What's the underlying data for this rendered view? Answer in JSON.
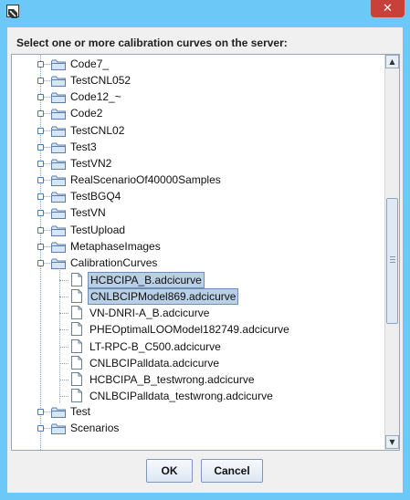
{
  "window": {
    "close_symbol": "✕"
  },
  "dialog": {
    "prompt": "Select one or more calibration curves on the server:",
    "ok_label": "OK",
    "cancel_label": "Cancel"
  },
  "tree": {
    "folders_before": [
      "Code7_",
      "TestCNL052",
      "Code12_~",
      "Code2",
      "TestCNL02",
      "Test3",
      "TestVN2",
      "RealScenarioOf40000Samples",
      "TestBGQ4",
      "TestVN",
      "TestUpload",
      "MetaphaseImages"
    ],
    "expanded_folder": "CalibrationCurves",
    "files": [
      {
        "label": "HCBCIPA_B.adcicurve",
        "selected": true
      },
      {
        "label": "CNLBCIPModel869.adcicurve",
        "selected": true
      },
      {
        "label": "VN-DNRI-A_B.adcicurve",
        "selected": false
      },
      {
        "label": "PHEOptimalLOOModel182749.adcicurve",
        "selected": false
      },
      {
        "label": "LT-RPC-B_C500.adcicurve",
        "selected": false
      },
      {
        "label": "CNLBCIPalldata.adcicurve",
        "selected": false
      },
      {
        "label": "HCBCIPA_B_testwrong.adcicurve",
        "selected": false
      },
      {
        "label": "CNLBCIPalldata_testwrong.adcicurve",
        "selected": false
      }
    ],
    "folders_after": [
      "Test",
      "Scenarios"
    ]
  },
  "colors": {
    "titlebar": "#6cc9f7",
    "close": "#c7403a",
    "selection": "#b8cfe5",
    "folder": "#d6e6f7"
  },
  "icons": {
    "folder": "folder-icon",
    "file": "file-icon",
    "expand": "expand-knob-icon"
  }
}
